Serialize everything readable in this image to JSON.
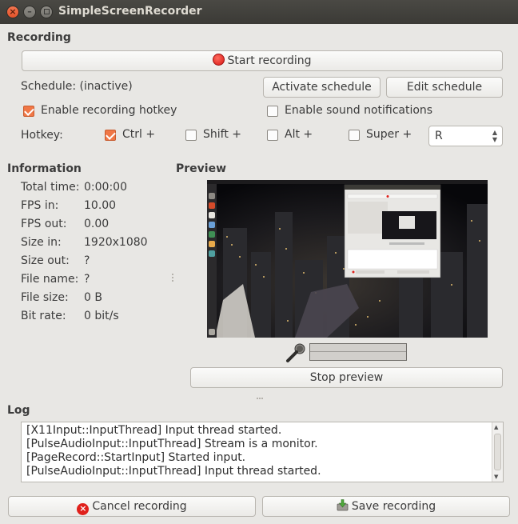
{
  "window": {
    "title": "SimpleScreenRecorder"
  },
  "recording": {
    "section_title": "Recording",
    "start_label": "Start recording",
    "schedule_status": "Schedule: (inactive)",
    "activate_schedule": "Activate schedule",
    "edit_schedule": "Edit schedule",
    "enable_hotkey": {
      "label": "Enable recording hotkey",
      "checked": true
    },
    "sound_notifications": {
      "label": "Enable sound notifications",
      "checked": false
    },
    "hotkey_label": "Hotkey:",
    "modifiers": [
      {
        "label": "Ctrl +",
        "checked": true
      },
      {
        "label": "Shift +",
        "checked": false
      },
      {
        "label": "Alt +",
        "checked": false
      },
      {
        "label": "Super +",
        "checked": false
      }
    ],
    "hotkey_key": "R"
  },
  "information": {
    "section_title": "Information",
    "rows": [
      {
        "key": "Total time:",
        "value": "0:00:00"
      },
      {
        "key": "FPS in:",
        "value": "10.00"
      },
      {
        "key": "FPS out:",
        "value": "0.00"
      },
      {
        "key": "Size in:",
        "value": "1920x1080"
      },
      {
        "key": "Size out:",
        "value": "?"
      },
      {
        "key": "File name:",
        "value": "?"
      },
      {
        "key": "File size:",
        "value": "0 B"
      },
      {
        "key": "Bit rate:",
        "value": "0 bit/s"
      }
    ]
  },
  "preview": {
    "section_title": "Preview",
    "stop_label": "Stop preview",
    "audio_level": 0
  },
  "log": {
    "section_title": "Log",
    "lines": [
      "[X11Input::InputThread] Input thread started.",
      "[PulseAudioInput::InputThread] Stream is a monitor.",
      "[PageRecord::StartInput] Started input.",
      "[PulseAudioInput::InputThread] Input thread started."
    ]
  },
  "footer": {
    "cancel_label": "Cancel recording",
    "save_label": "Save recording"
  },
  "colors": {
    "accent": "#f07746",
    "record_red": "#e0201b",
    "titlebar": "#3c3b37"
  },
  "icons": [
    "close-icon",
    "minimize-icon",
    "maximize-icon",
    "record-icon",
    "microphone-icon",
    "cancel-icon",
    "save-icon"
  ]
}
